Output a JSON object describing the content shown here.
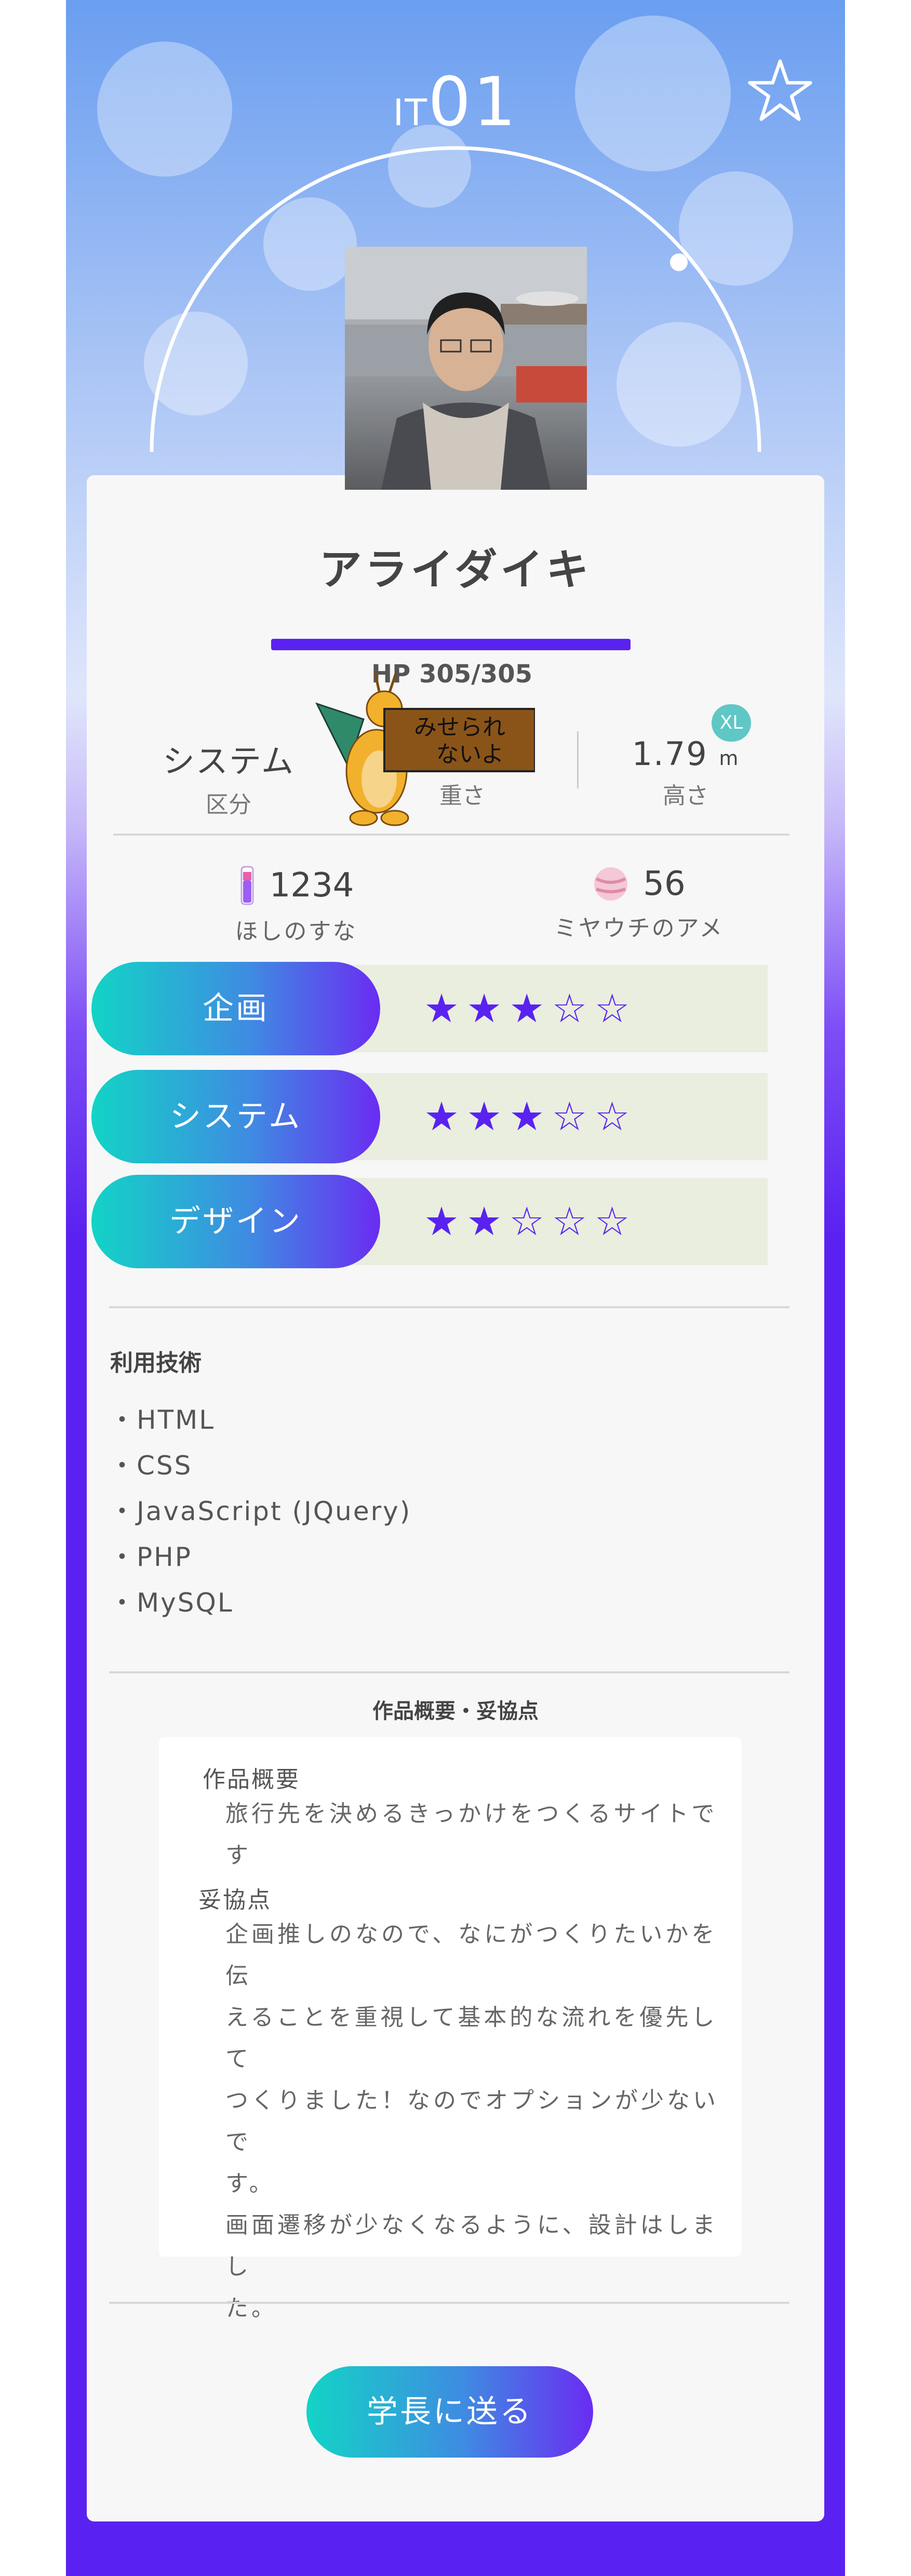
{
  "header": {
    "title_prefix": "IT",
    "title_number": "01"
  },
  "profile": {
    "name": "アライダイキ"
  },
  "hp": {
    "text": "HP 305/305",
    "fraction": 1.0
  },
  "stats": {
    "category": {
      "value": "システム",
      "label": "区分"
    },
    "weight": {
      "label": "重さ"
    },
    "height": {
      "value": "1.79",
      "unit": "m",
      "label": "高さ",
      "badge": "XL"
    }
  },
  "sticker": {
    "text_line1": "みせられ",
    "text_line2": "ないよ"
  },
  "resources": {
    "stardust": {
      "value": "1234",
      "label": "ほしのすな"
    },
    "candy": {
      "value": "56",
      "label": "ミヤウチのアメ"
    }
  },
  "skills": [
    {
      "label": "企画",
      "stars": "★★★☆☆",
      "rating": 3
    },
    {
      "label": "システム",
      "stars": "★★★☆☆",
      "rating": 3
    },
    {
      "label": "デザイン",
      "stars": "★★☆☆☆",
      "rating": 2
    }
  ],
  "tech": {
    "heading": "利用技術",
    "items": [
      "HTML",
      "CSS",
      "JavaScript (JQuery)",
      "PHP",
      "MySQL"
    ]
  },
  "description": {
    "heading": "作品概要・妥協点",
    "summary_label": "作品概要",
    "summary_text": "旅行先を決めるきっかけをつくるサイトです",
    "compromise_label": "妥協点",
    "compromise_lines": [
      "企画推しのなので、なにがつくりたいかを伝",
      "えることを重視して基本的な流れを優先して",
      "つくりました！なのでオプションが少ないで",
      "す。",
      "画面遷移が少なくなるように、設計はしまし",
      "た。"
    ]
  },
  "actions": {
    "send_label": "学長に送る"
  },
  "colors": {
    "accent": "#5a22f0",
    "teal": "#12d4c6",
    "skill_bg": "#e9eedf",
    "badge": "#5fc7c6"
  },
  "icons": {
    "favorite": "star-outline-icon",
    "stardust": "stardust-vial-icon",
    "candy": "candy-icon"
  }
}
